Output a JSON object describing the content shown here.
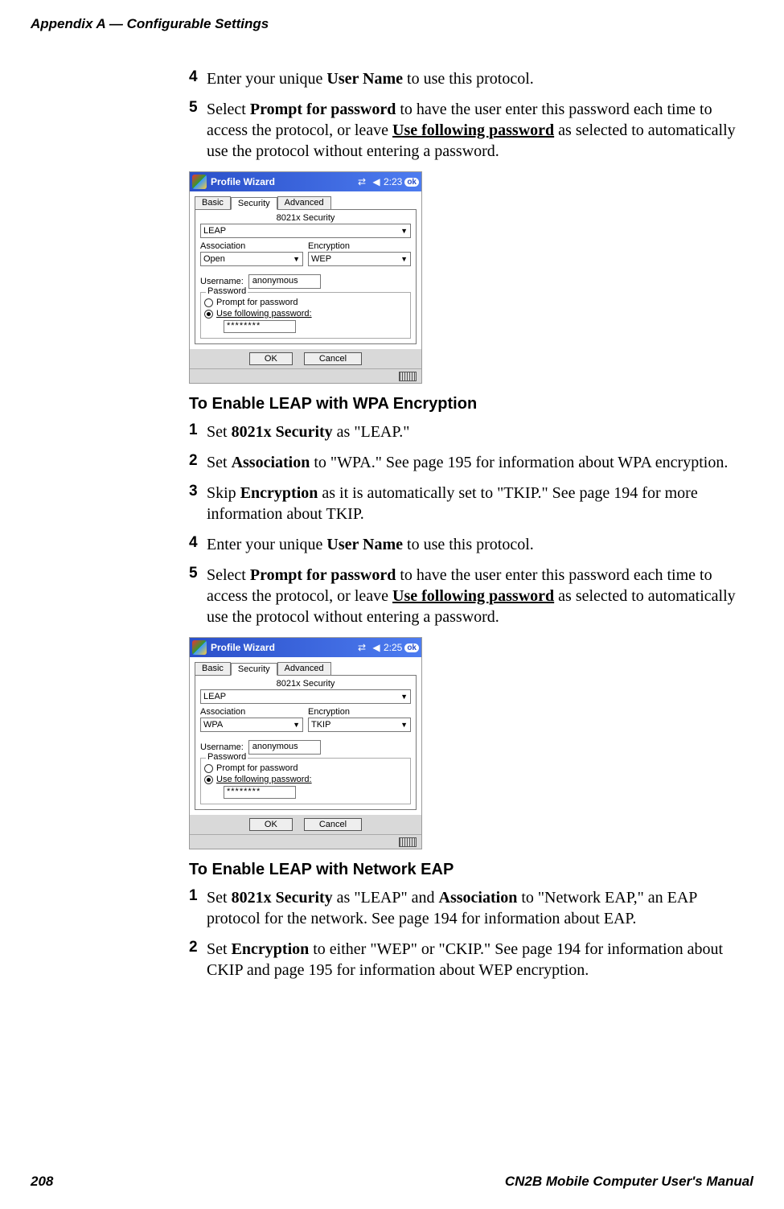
{
  "header": {
    "text": "Appendix A — Configurable Settings"
  },
  "footer": {
    "page": "208",
    "manual": "CN2B Mobile Computer User's Manual"
  },
  "top_steps": {
    "step4": {
      "num": "4",
      "pre": "Enter your unique ",
      "bold": "User Name",
      "post": " to use this protocol."
    },
    "step5": {
      "num": "5",
      "a": "Select ",
      "b": "Prompt for password",
      "c": " to have the user enter this password each time to access the protocol, or leave ",
      "d": "Use following password",
      "e": " as selected to automatically use the protocol without entering a password."
    }
  },
  "shot1": {
    "title": "Profile Wizard",
    "time": "2:23",
    "ok": "ok",
    "tabs": {
      "basic": "Basic",
      "security": "Security",
      "advanced": "Advanced"
    },
    "sec_label": "8021x Security",
    "sec_value": "LEAP",
    "assoc_label": "Association",
    "assoc_value": "Open",
    "enc_label": "Encryption",
    "enc_value": "WEP",
    "user_label": "Username:",
    "user_value": "anonymous",
    "pw_legend": "Password",
    "prompt": "Prompt for password",
    "usefollowing": "Use following password:",
    "pw_value": "********",
    "ok_btn": "OK",
    "cancel_btn": "Cancel"
  },
  "section1": {
    "heading": "To Enable LEAP with WPA Encryption",
    "step1": {
      "num": "1",
      "a": "Set ",
      "b": "8021x Security",
      "c": " as \"LEAP.\""
    },
    "step2": {
      "num": "2",
      "a": "Set ",
      "b": "Association",
      "c": " to \"WPA.\" See page 195 for information about WPA encryption."
    },
    "step3": {
      "num": "3",
      "a": "Skip ",
      "b": "Encryption",
      "c": " as it is automatically set to \"TKIP.\" See page 194 for more information about TKIP."
    },
    "step4": {
      "num": "4",
      "a": "Enter your unique ",
      "b": "User Name",
      "c": " to use this protocol."
    },
    "step5": {
      "num": "5",
      "a": "Select ",
      "b": "Prompt for password",
      "c": " to have the user enter this password each time to access the protocol, or leave ",
      "d": "Use following password",
      "e": " as selected to automatically use the protocol without entering a password."
    }
  },
  "shot2": {
    "title": "Profile Wizard",
    "time": "2:25",
    "ok": "ok",
    "tabs": {
      "basic": "Basic",
      "security": "Security",
      "advanced": "Advanced"
    },
    "sec_label": "8021x Security",
    "sec_value": "LEAP",
    "assoc_label": "Association",
    "assoc_value": "WPA",
    "enc_label": "Encryption",
    "enc_value": "TKIP",
    "user_label": "Username:",
    "user_value": "anonymous",
    "pw_legend": "Password",
    "prompt": "Prompt for password",
    "usefollowing": "Use following password:",
    "pw_value": "********",
    "ok_btn": "OK",
    "cancel_btn": "Cancel"
  },
  "section2": {
    "heading": "To Enable LEAP with Network EAP",
    "step1": {
      "num": "1",
      "a": "Set ",
      "b": "8021x Security",
      "c": " as \"LEAP\" and ",
      "d": "Association",
      "e": " to \"Network EAP,\" an EAP protocol for the network. See page 194 for information about EAP."
    },
    "step2": {
      "num": "2",
      "a": "Set ",
      "b": "Encryption",
      "c": " to either \"WEP\" or \"CKIP.\" See page 194 for information about CKIP and page 195 for information about WEP encryption."
    }
  }
}
